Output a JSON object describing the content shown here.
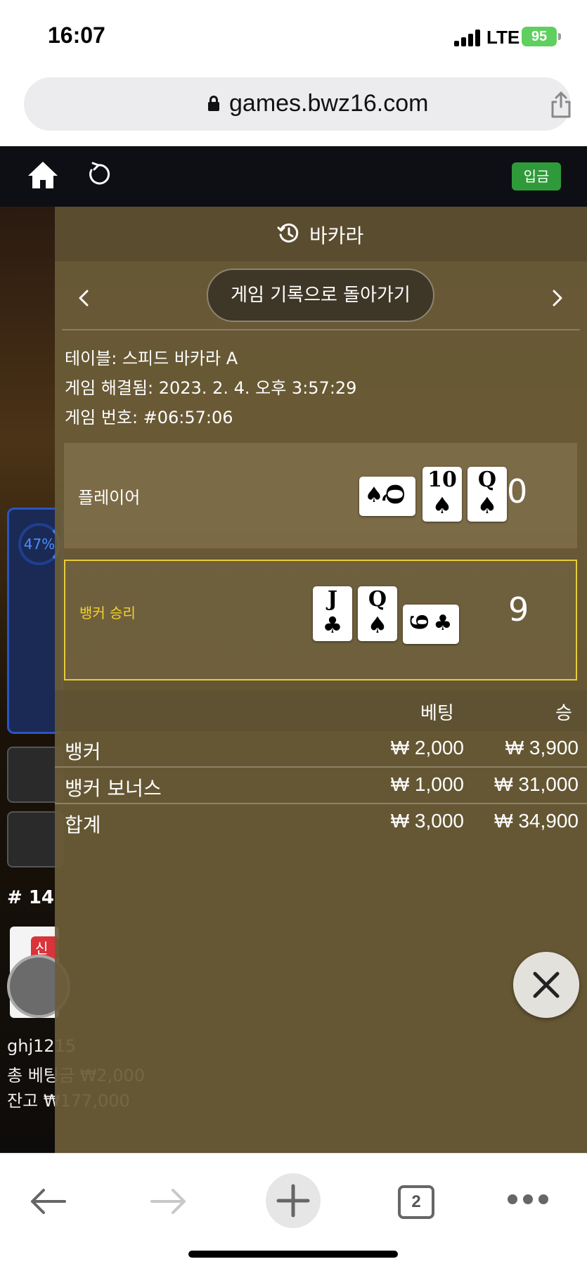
{
  "status": {
    "time": "16:07",
    "network": "LTE",
    "battery": "95"
  },
  "browser": {
    "url": "games.bwz16.com"
  },
  "header": {
    "deposit_label": "입금"
  },
  "background": {
    "percent": "47%",
    "round_number": "# 14",
    "new_badge": "신규",
    "footer_line1": "ghj1215",
    "footer_line2": "총 베팅금 ₩2,000",
    "footer_line3": "잔고 ₩177,000"
  },
  "modal": {
    "title": "바카라",
    "back_button": "게임 기록으로 돌아가기",
    "table_info": "테이블: 스피드 바카라 A",
    "resolved_info": "게임 해결됨: 2023. 2. 4. 오후 3:57:29",
    "game_number_info": "게임 번호: #06:57:06",
    "player": {
      "label": "플레이어",
      "score": "0",
      "cards": [
        {
          "rank": "Q",
          "suit": "♠",
          "orientation": "sideways"
        },
        {
          "rank": "10",
          "suit": "♠",
          "orientation": "upright"
        },
        {
          "rank": "Q",
          "suit": "♠",
          "orientation": "upright"
        }
      ]
    },
    "banker": {
      "label": "뱅커 승리",
      "score": "9",
      "cards": [
        {
          "rank": "J",
          "suit": "♣",
          "orientation": "upright"
        },
        {
          "rank": "Q",
          "suit": "♠",
          "orientation": "upright"
        },
        {
          "rank": "9",
          "suit": "♣",
          "orientation": "sideways"
        }
      ]
    },
    "bets_header": {
      "bet": "베팅",
      "win": "승"
    },
    "bets": [
      {
        "name": "뱅커",
        "bet": "₩ 2,000",
        "win": "₩ 3,900"
      },
      {
        "name": "뱅커 보너스",
        "bet": "₩ 1,000",
        "win": "₩ 31,000"
      }
    ],
    "total": {
      "name": "합계",
      "bet": "₩ 3,000",
      "win": "₩ 34,900"
    }
  },
  "toolbar": {
    "tab_count": "2"
  },
  "colors": {
    "modal_bg": "#6c5c38",
    "winner_border": "#e8cc3a",
    "deposit_green": "#2f9a3a"
  }
}
